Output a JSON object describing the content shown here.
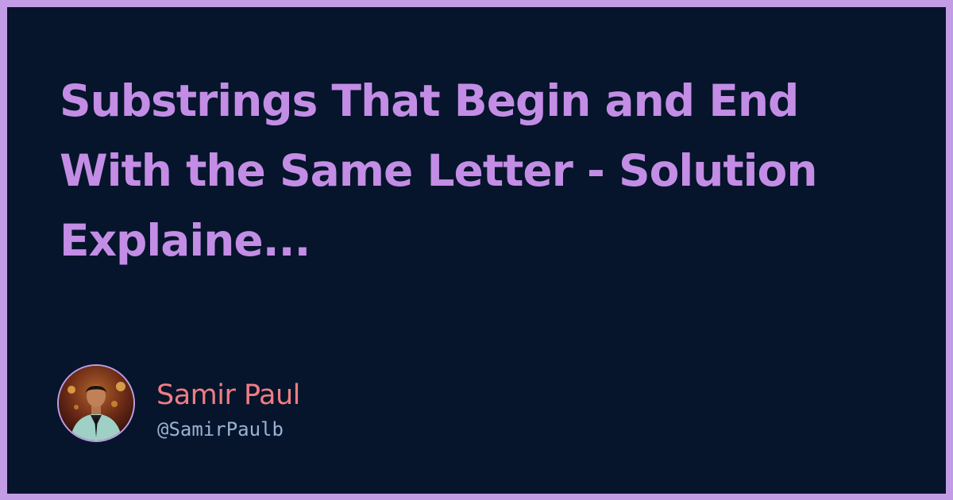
{
  "post": {
    "title": "Substrings That Begin and End With the Same Letter - Solution Explaine..."
  },
  "author": {
    "name": "Samir Paul",
    "handle": "@SamirPaulb",
    "avatar_icon": "profile-photo"
  },
  "colors": {
    "border": "#c39ce6",
    "background": "#06152b",
    "title": "#c38de5",
    "name": "#ee7d83",
    "handle": "#9ab1d2"
  }
}
